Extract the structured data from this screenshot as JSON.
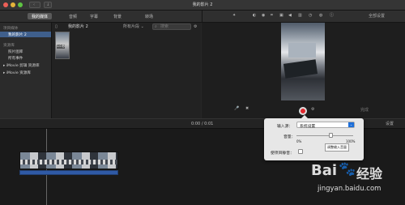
{
  "window": {
    "title": "我的影片 2"
  },
  "toolbar": {
    "tabs": [
      "我的媒体",
      "音频",
      "字幕",
      "背景",
      "转场"
    ],
    "settings_label": "全部设置"
  },
  "sidebar": {
    "section_label": "项目媒体",
    "project_item": "我的影片 2",
    "library_section": "资源库",
    "items": [
      "照片图库",
      "所有事件",
      "iMovie 剪辑 资源库",
      "iMovie 资源库"
    ]
  },
  "browser": {
    "title": "我的影片 2",
    "filter": "所有片段",
    "search_placeholder": "搜索",
    "clip_duration": "1.0 秒"
  },
  "viewer": {
    "done_label": "完成"
  },
  "timeline": {
    "timecode": "0:00 / 0:01",
    "settings_label": "设置"
  },
  "popover": {
    "input_label": "输入源：",
    "input_value": "系统设置",
    "volume_label": "音量：",
    "volume_min": "0%",
    "volume_max": "100%",
    "volume_level": 0.6,
    "tooltip": "调整输入音量",
    "mute_label": "使项目静音："
  },
  "watermark": {
    "brand_left": "Bai",
    "brand_right": "经验",
    "url": "jingyan.baidu.com"
  },
  "colors": {
    "accent": "#1e6fd9",
    "record": "#e0282d",
    "track": "#2f5aa6"
  }
}
